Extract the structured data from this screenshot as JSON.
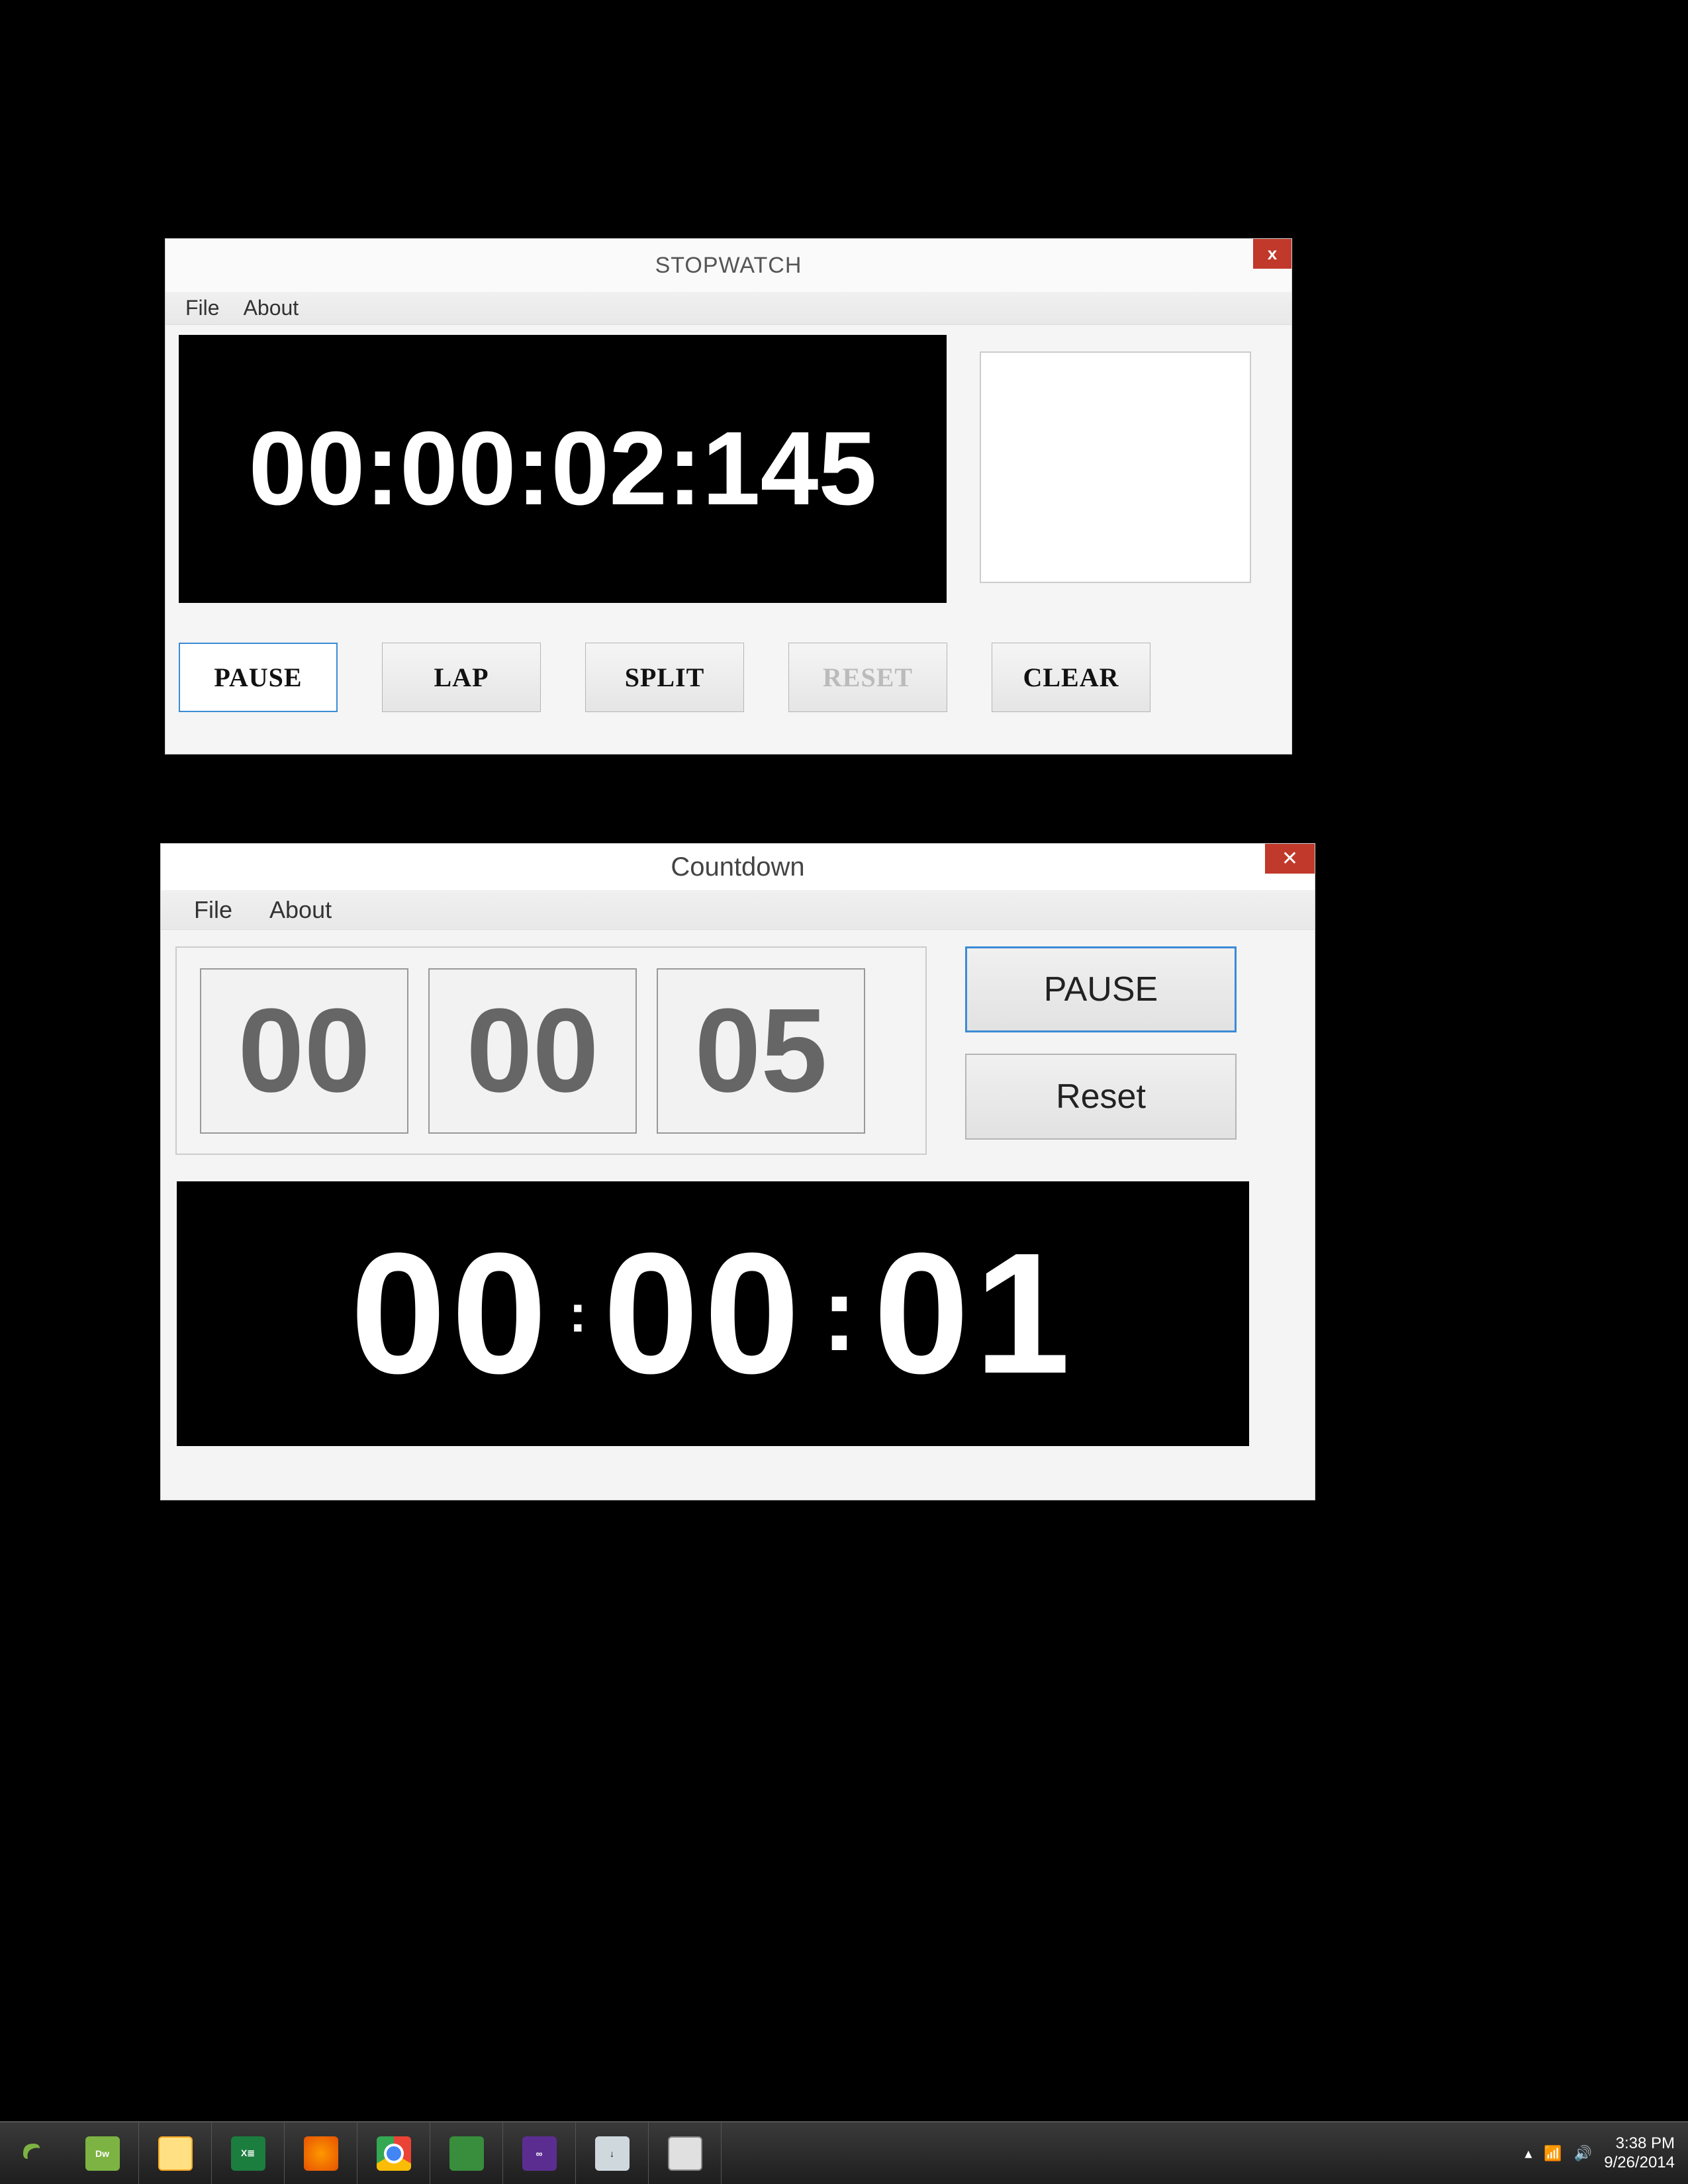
{
  "stopwatch": {
    "title": "STOPWATCH",
    "close_label": "x",
    "menu": {
      "file": "File",
      "about": "About"
    },
    "display_value": "00:00:02:145",
    "buttons": {
      "pause": "PAUSE",
      "lap": "LAP",
      "split": "SPLIT",
      "reset": "RESET",
      "clear": "CLEAR"
    }
  },
  "countdown": {
    "title": "Countdown",
    "close_label": "✕",
    "menu": {
      "file": "File",
      "about": "About"
    },
    "inputs": {
      "hh": "00",
      "mm": "00",
      "ss": "05"
    },
    "buttons": {
      "pause": "PAUSE",
      "reset": "Reset"
    },
    "output": {
      "hh": "00",
      "mm": "00",
      "ss": "01"
    }
  },
  "taskbar": {
    "items": [
      {
        "name": "dreamweaver",
        "label": "Dw"
      },
      {
        "name": "file-explorer",
        "label": ""
      },
      {
        "name": "excel",
        "label": "X≣"
      },
      {
        "name": "firefox",
        "label": ""
      },
      {
        "name": "chrome",
        "label": ""
      },
      {
        "name": "android-studio",
        "label": ""
      },
      {
        "name": "visual-studio",
        "label": "∞"
      },
      {
        "name": "downloads",
        "label": "↓"
      },
      {
        "name": "running-app",
        "label": ""
      }
    ],
    "tray": {
      "expand": "▴",
      "network": "📶",
      "volume": "🔊"
    },
    "time": "3:38 PM",
    "date": "9/26/2014"
  }
}
